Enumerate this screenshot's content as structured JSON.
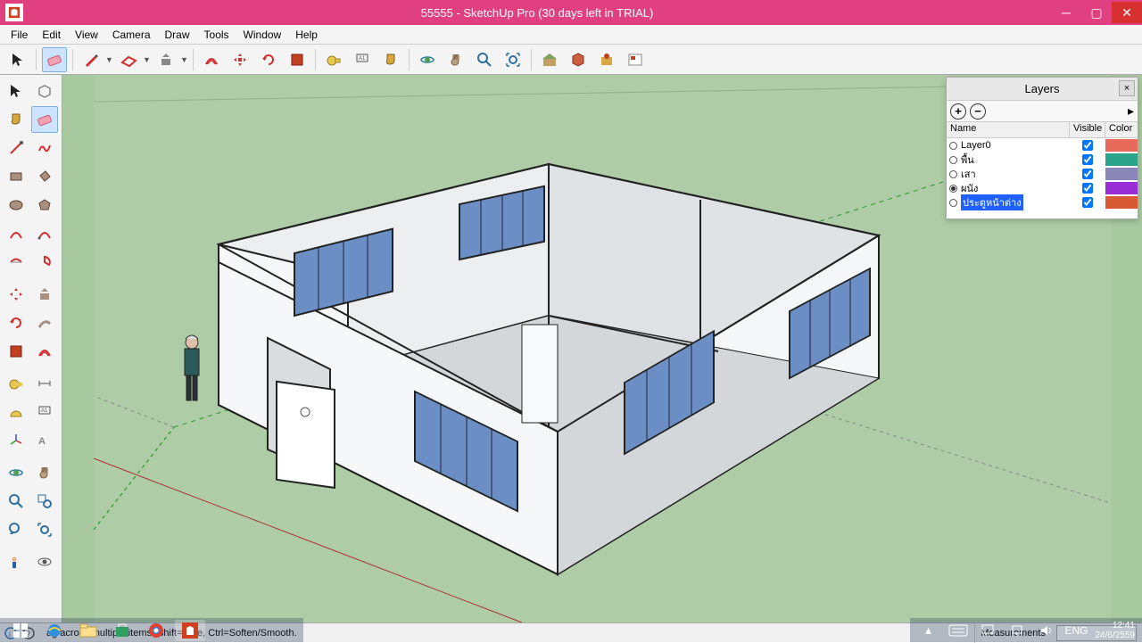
{
  "titlebar": {
    "title": "55555 - SketchUp Pro (30 days left in TRIAL)"
  },
  "menubar": [
    "File",
    "Edit",
    "View",
    "Camera",
    "Draw",
    "Tools",
    "Window",
    "Help"
  ],
  "layers_panel": {
    "title": "Layers",
    "cols": {
      "name": "Name",
      "visible": "Visible",
      "color": "Color"
    },
    "rows": [
      {
        "name": "Layer0",
        "visible": true,
        "active": false,
        "color": "#e86a5a",
        "selected": false
      },
      {
        "name": "พื้น",
        "visible": true,
        "active": false,
        "color": "#2aa58a",
        "selected": false
      },
      {
        "name": "เสา",
        "visible": true,
        "active": false,
        "color": "#8a86b8",
        "selected": false
      },
      {
        "name": "ผนัง",
        "visible": true,
        "active": true,
        "color": "#9a2ed6",
        "selected": false
      },
      {
        "name": "ประตูหน้าต่าง",
        "visible": true,
        "active": false,
        "color": "#d85a34",
        "selected": true
      }
    ]
  },
  "statusbar": {
    "hint": "ag across multiple items. Shift=Hide, Ctrl=Soften/Smooth.",
    "measurements_label": "Measurements",
    "lang": "ENG",
    "time": "12:41",
    "date": "24/6/2559"
  }
}
